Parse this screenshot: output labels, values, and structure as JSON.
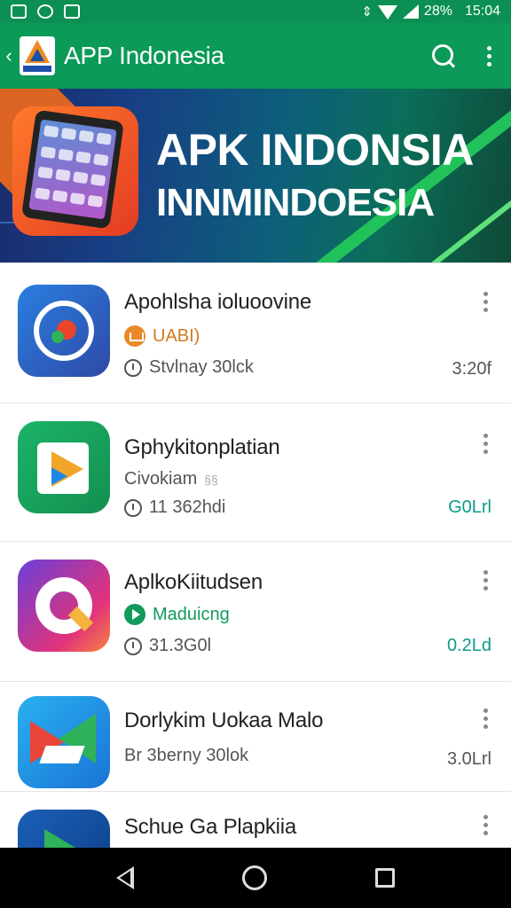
{
  "status_bar": {
    "icons_left": [
      "image-icon",
      "refresh-icon",
      "font-icon"
    ],
    "battery": "28%",
    "time": "15:04"
  },
  "app_bar": {
    "title": "APP Indonesia",
    "actions": [
      "search-icon",
      "more-vert-icon"
    ]
  },
  "banner": {
    "title": "APK INDONSIA",
    "subtitle": "INNMINDOESIA"
  },
  "apps": [
    {
      "name": "Apohlsha ioluoovine",
      "line2_badge": "orange",
      "line2_label": "UABI)",
      "line2_extra": "",
      "line3": "Stvlnay 30lck",
      "size": "3:20f",
      "size_color": "#555"
    },
    {
      "name": "Gphykitonplatian",
      "line2_badge": "",
      "line2_label": "Civokiam",
      "line2_extra": "§§",
      "line3": "11 362hdi",
      "size": "G0Lrl",
      "size_color": "#0d9a8a"
    },
    {
      "name": "AplkoKiitudsen",
      "line2_badge": "green",
      "line2_label": "Maduicng",
      "line2_extra": "",
      "line3": "31.3G0l",
      "size": "0.2Ld",
      "size_color": "#0d9a8a"
    },
    {
      "name": "Dorlykim Uokaa Malo",
      "line2_badge": "",
      "line2_label": "Br 3berny 30lok",
      "line2_extra": "",
      "line3": "",
      "size": "3.0Lrl",
      "size_color": "#555"
    },
    {
      "name": "Schue Ga Plapkiia",
      "line2_badge": "",
      "line2_label": "",
      "line2_extra": "",
      "line3": "",
      "size": "",
      "size_color": "#555"
    }
  ],
  "nav_bar": [
    "back-icon",
    "home-icon",
    "recents-icon"
  ]
}
